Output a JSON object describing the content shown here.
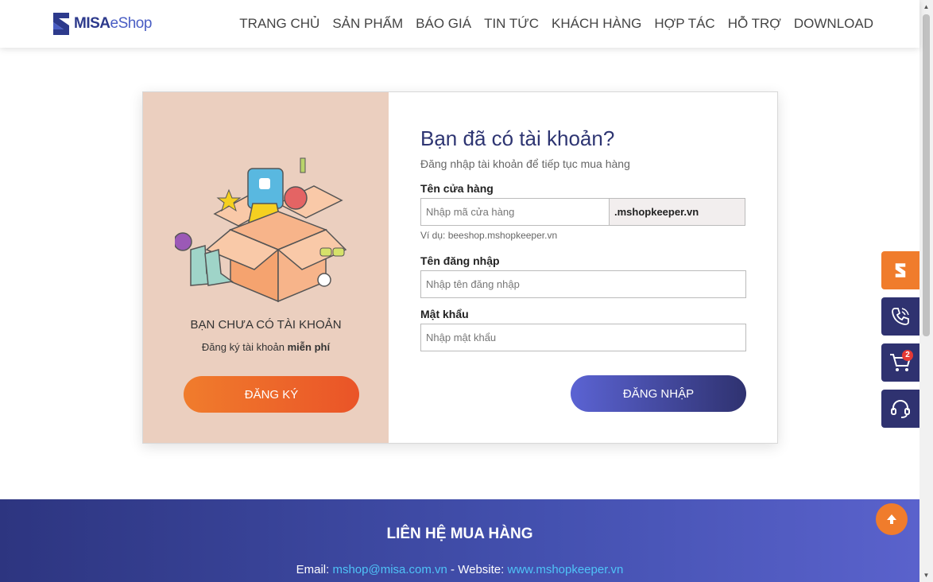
{
  "header": {
    "logo_part1": "MISA",
    "logo_part2": "eShop",
    "nav": [
      "TRANG CHỦ",
      "SẢN PHẨM",
      "BÁO GIÁ",
      "TIN TỨC",
      "KHÁCH HÀNG",
      "HỢP TÁC",
      "HỖ TRỢ",
      "DOWNLOAD"
    ]
  },
  "register_panel": {
    "no_account": "BẠN CHƯA CÓ TÀI KHOẢN",
    "note_prefix": "Đăng ký tài khoản ",
    "note_bold": "miễn phí",
    "register_button": "ĐĂNG KÝ"
  },
  "login_form": {
    "title": "Bạn đã có tài khoản?",
    "subtitle": "Đăng nhập tài khoản để tiếp tục mua hàng",
    "store_label": "Tên cửa hàng",
    "store_placeholder": "Nhập mã cửa hàng",
    "store_suffix": ".mshopkeeper.vn",
    "store_example": "Ví dụ: beeshop.mshopkeeper.vn",
    "username_label": "Tên đăng nhập",
    "username_placeholder": "Nhập tên đăng nhập",
    "password_label": "Mật khẩu",
    "password_placeholder": "Nhập mật khẩu",
    "login_button": "ĐĂNG NHẬP"
  },
  "side_buttons": {
    "cart_count": "2"
  },
  "footer": {
    "title": "LIÊN HỆ MUA HÀNG",
    "email_label": "Email: ",
    "email": "mshop@misa.com.vn",
    "separator": " - Website: ",
    "website": "www.mshopkeeper.vn"
  },
  "colors": {
    "brand_navy": "#2f3270",
    "brand_orange": "#f07c2c",
    "left_panel_bg": "#ebcfbf"
  }
}
